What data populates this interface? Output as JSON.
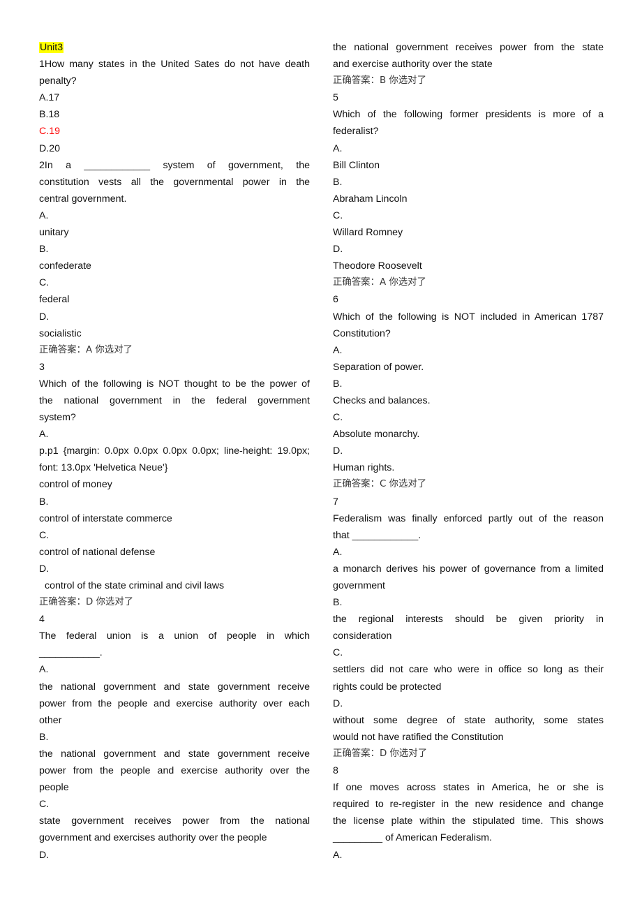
{
  "document": {
    "unit_title": "Unit3",
    "answer_prefix": "正确答案：",
    "answer_suffix": " 你选对了",
    "left_column": [
      {
        "text": "Unit3",
        "style": "highlight"
      },
      {
        "text": "1How many states in the United Sates do not have death",
        "style": "justify"
      },
      {
        "text": "penalty?"
      },
      {
        "text": "A.17"
      },
      {
        "text": "B.18"
      },
      {
        "text": "C.19",
        "style": "red"
      },
      {
        "text": "D.20"
      },
      {
        "text": "2In a ____________ system of government, the",
        "style": "justify"
      },
      {
        "text": "constitution vests all the governmental power in the",
        "style": "justify"
      },
      {
        "text": "central government."
      },
      {
        "text": "A."
      },
      {
        "text": "unitary"
      },
      {
        "text": "B."
      },
      {
        "text": "confederate"
      },
      {
        "text": "C."
      },
      {
        "text": "federal"
      },
      {
        "text": "D."
      },
      {
        "text": "socialistic"
      },
      {
        "text": "正确答案：A 你选对了",
        "style": "answer"
      },
      {
        "text": "3"
      },
      {
        "text": "Which of the following is NOT thought to be the power of",
        "style": "justify"
      },
      {
        "text": "the national government in the federal government",
        "style": "justify"
      },
      {
        "text": "system?"
      },
      {
        "text": "A."
      },
      {
        "text": "p.p1 {margin: 0.0px 0.0px 0.0px 0.0px; line-height: 19.0px;",
        "style": "justify"
      },
      {
        "text": "font: 13.0px 'Helvetica Neue'}"
      },
      {
        "text": "control of money"
      },
      {
        "text": "B."
      },
      {
        "text": "control of interstate commerce"
      },
      {
        "text": "C."
      },
      {
        "text": "control of national defense"
      },
      {
        "text": "D."
      },
      {
        "text": "control of the state criminal and civil laws",
        "style": "indent"
      },
      {
        "text": "正确答案：D 你选对了",
        "style": "answer"
      },
      {
        "text": "4"
      },
      {
        "text": "The federal union is a union of people in which",
        "style": "justify"
      },
      {
        "text": "___________."
      },
      {
        "text": "A."
      },
      {
        "text": "the national government and state government receive",
        "style": "justify"
      },
      {
        "text": "power from the people and exercise authority over each",
        "style": "justify"
      },
      {
        "text": "other"
      },
      {
        "text": "B."
      },
      {
        "text": "the national government and state government receive",
        "style": "justify"
      },
      {
        "text": "power from the people and exercise authority over the",
        "style": "justify"
      },
      {
        "text": "people"
      },
      {
        "text": "C."
      },
      {
        "text": "state government receives power from the national",
        "style": "justify"
      },
      {
        "text": "government and exercises authority over the people"
      },
      {
        "text": "D."
      }
    ],
    "right_column": [
      {
        "text": "the national government receives power from the state",
        "style": "justify"
      },
      {
        "text": "and exercise authority over the state"
      },
      {
        "text": "正确答案：B 你选对了",
        "style": "answer"
      },
      {
        "text": "5"
      },
      {
        "text": "Which of the following former presidents is more of a",
        "style": "justify"
      },
      {
        "text": "federalist?"
      },
      {
        "text": "A."
      },
      {
        "text": "Bill Clinton"
      },
      {
        "text": "B."
      },
      {
        "text": "Abraham Lincoln"
      },
      {
        "text": "C."
      },
      {
        "text": "Willard Romney"
      },
      {
        "text": "D."
      },
      {
        "text": "Theodore Roosevelt"
      },
      {
        "text": "正确答案：A 你选对了",
        "style": "answer"
      },
      {
        "text": "6"
      },
      {
        "text": "Which of the following is NOT included in American 1787",
        "style": "justify"
      },
      {
        "text": "Constitution?"
      },
      {
        "text": "A."
      },
      {
        "text": "Separation of power."
      },
      {
        "text": "B."
      },
      {
        "text": "Checks and balances."
      },
      {
        "text": "C."
      },
      {
        "text": "Absolute monarchy."
      },
      {
        "text": "D."
      },
      {
        "text": "Human rights."
      },
      {
        "text": "正确答案：C 你选对了",
        "style": "answer"
      },
      {
        "text": "7"
      },
      {
        "text": "Federalism was finally enforced partly out of the reason",
        "style": "justify"
      },
      {
        "text": "that ____________."
      },
      {
        "text": "A."
      },
      {
        "text": "a monarch derives his power of governance from a limited",
        "style": "justify"
      },
      {
        "text": "government"
      },
      {
        "text": "B."
      },
      {
        "text": "the regional interests should be given priority in",
        "style": "justify"
      },
      {
        "text": "consideration"
      },
      {
        "text": "C."
      },
      {
        "text": "settlers did not care who were in office so long as their",
        "style": "justify"
      },
      {
        "text": "rights could be protected"
      },
      {
        "text": "D."
      },
      {
        "text": "without some degree of state authority, some states",
        "style": "justify"
      },
      {
        "text": "would not have ratified the Constitution"
      },
      {
        "text": "正确答案：D 你选对了",
        "style": "answer"
      },
      {
        "text": "8"
      },
      {
        "text": "If one moves across states in America, he or she is",
        "style": "justify"
      },
      {
        "text": "required to re-register in the new residence and change",
        "style": "justify"
      },
      {
        "text": "the license plate within the stipulated time. This shows",
        "style": "justify"
      },
      {
        "text": "_________ of American Federalism."
      },
      {
        "text": "A."
      }
    ]
  },
  "colors": {
    "highlight": "#ffff00",
    "correct_option": "#ff0000",
    "answer_text": "#3a3a3a",
    "body_text": "#111111"
  }
}
